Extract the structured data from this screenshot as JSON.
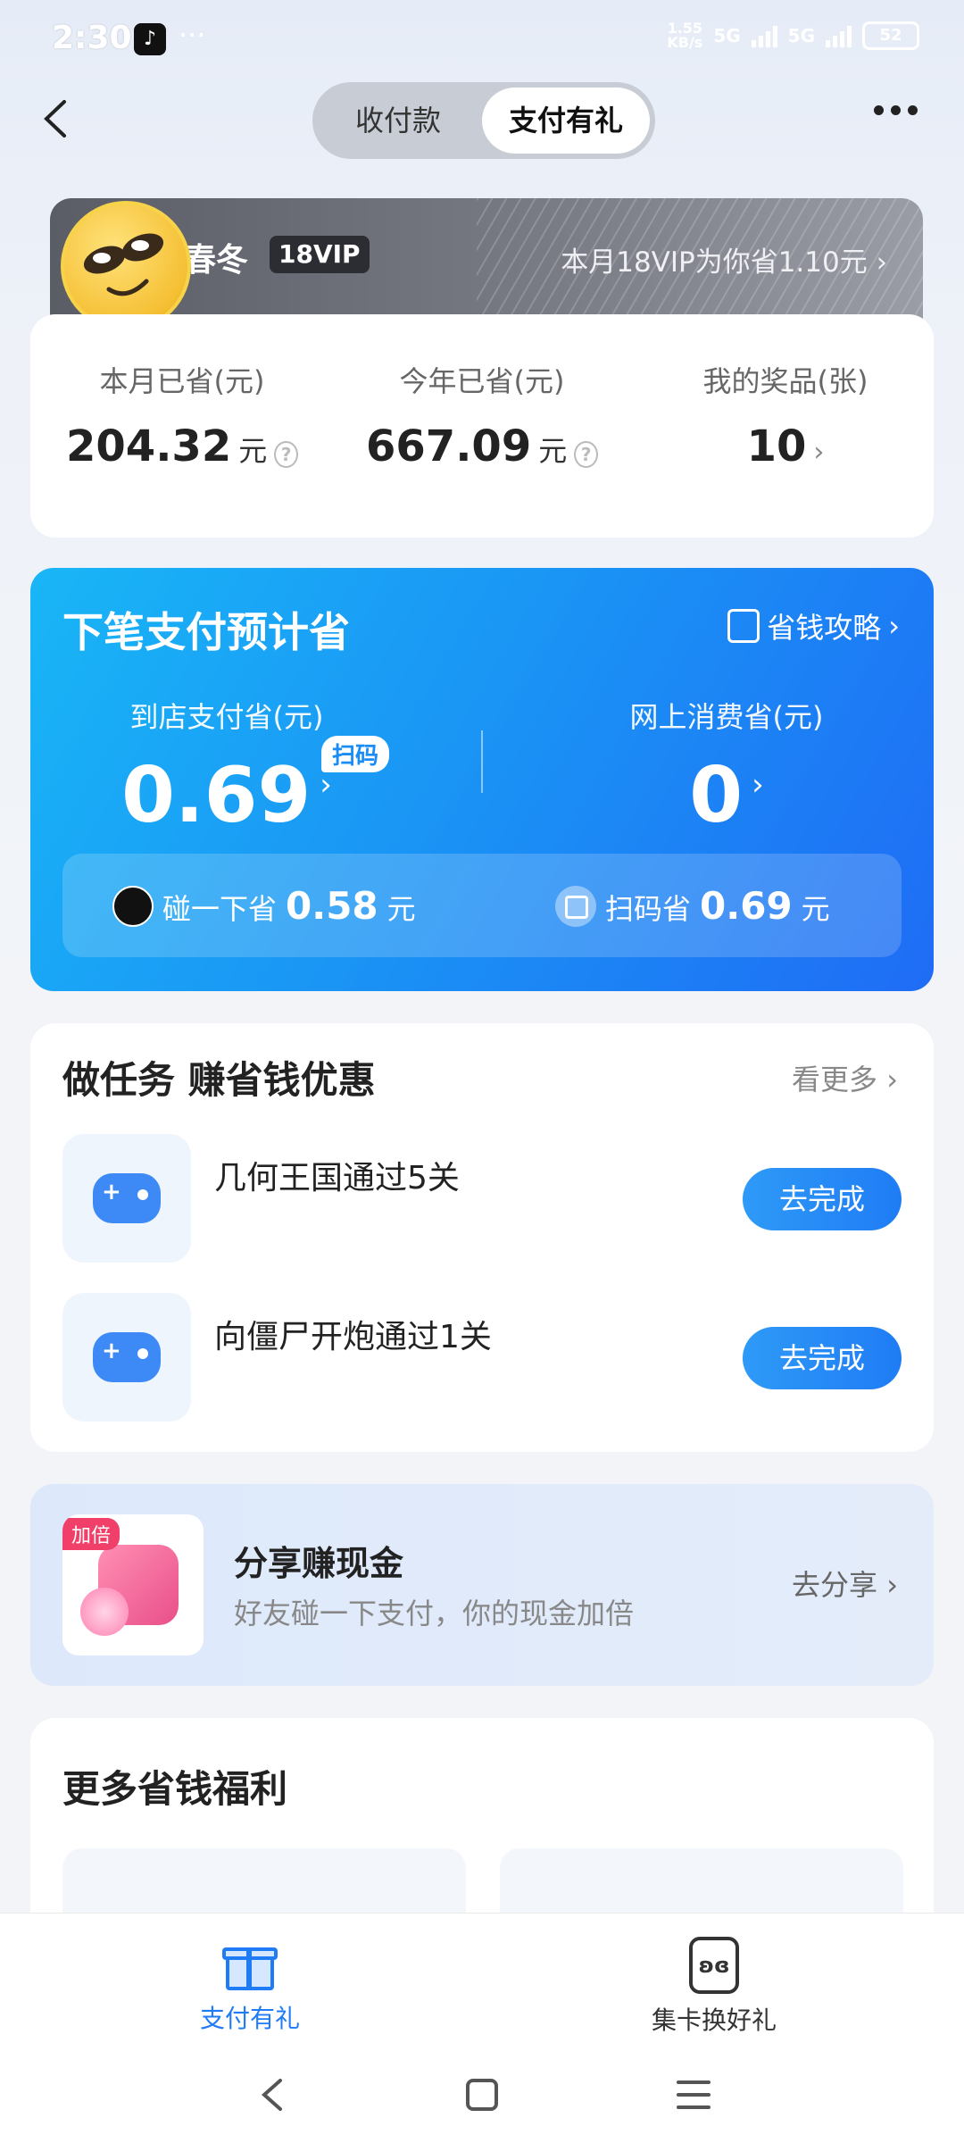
{
  "status_bar": {
    "time": "2:30",
    "dots": "···",
    "speed_top": "1.55",
    "speed_bottom": "KB/s",
    "signal1": "5G",
    "signal2": "5G",
    "battery": "52"
  },
  "header": {
    "tabs": [
      {
        "label": "收付款",
        "active": false
      },
      {
        "label": "支付有礼",
        "active": true
      }
    ]
  },
  "vip": {
    "name": "春冬",
    "badge": "18VIP",
    "save_text": "本月18VIP为你省1.10元",
    "chevron": "›"
  },
  "stats": [
    {
      "label": "本月已省(元)",
      "value": "204.32",
      "unit": "元"
    },
    {
      "label": "今年已省(元)",
      "value": "667.09",
      "unit": "元"
    },
    {
      "label": "我的奖品(张)",
      "value": "10",
      "unit": ""
    }
  ],
  "savings": {
    "title": "下笔支付预计省",
    "guide": "省钱攻略",
    "chevron": "›",
    "store": {
      "label": "到店支付省(元)",
      "value": "0.69",
      "tag": "扫码"
    },
    "online": {
      "label": "网上消费省(元)",
      "value": "0"
    },
    "bar": [
      {
        "label": "碰一下省",
        "value": "0.58",
        "unit": "元"
      },
      {
        "label": "扫码省",
        "value": "0.69",
        "unit": "元"
      }
    ]
  },
  "tasks": {
    "title": "做任务 赚省钱优惠",
    "more": "看更多 ›",
    "items": [
      {
        "name": "几何王国通过5关",
        "button": "去完成"
      },
      {
        "name": "向僵尸开炮通过1关",
        "button": "去完成"
      }
    ]
  },
  "share": {
    "tag": "加倍",
    "title": "分享赚现金",
    "subtitle": "好友碰一下支付，你的现金加倍",
    "action": "去分享 ›"
  },
  "benefits": {
    "title": "更多省钱福利"
  },
  "bottom_nav": [
    {
      "label": "支付有礼",
      "active": true,
      "color": "#1f7cf5"
    },
    {
      "label": "集卡换好礼",
      "active": false,
      "color": "#333333"
    }
  ],
  "card_icon_glyph": "ʚɞ",
  "help_glyph": "?"
}
